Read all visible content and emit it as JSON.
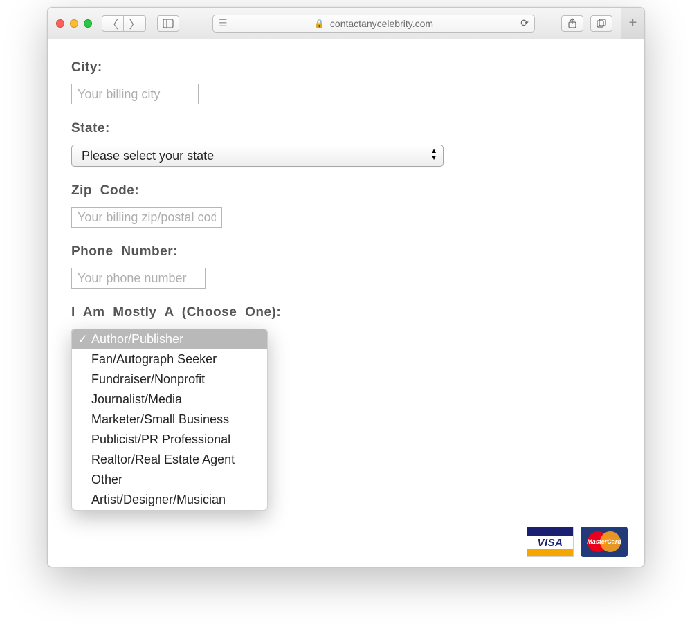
{
  "browser": {
    "url_host": "contactanycelebrity.com"
  },
  "form": {
    "city": {
      "label": "City:",
      "placeholder": "Your billing city",
      "value": ""
    },
    "state": {
      "label": "State:",
      "selected": "Please select your state"
    },
    "zip": {
      "label": "Zip Code:",
      "placeholder": "Your billing zip/postal code",
      "value": ""
    },
    "phone": {
      "label": "Phone Number:",
      "placeholder": "Your phone number",
      "value": ""
    },
    "role": {
      "label": "I Am Mostly A (Choose One):",
      "selected_index": 0,
      "options": [
        "Author/Publisher",
        "Fan/Autograph Seeker",
        "Fundraiser/Nonprofit",
        "Journalist/Media",
        "Marketer/Small Business",
        "Publicist/PR Professional",
        "Realtor/Real Estate Agent",
        "Other",
        "Artist/Designer/Musician"
      ]
    }
  },
  "cards": {
    "visa": "VISA",
    "mastercard": "MasterCard"
  }
}
